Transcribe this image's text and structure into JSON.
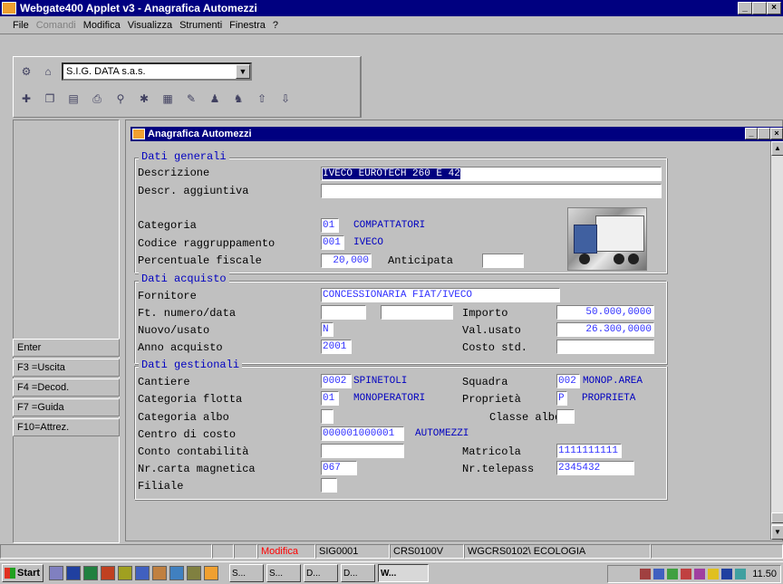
{
  "window": {
    "title": "Webgate400 Applet v3 - Anagrafica Automezzi",
    "btn_min": "_",
    "btn_max": " ",
    "btn_close": "×"
  },
  "menu": [
    "File",
    "Comandi",
    "Modifica",
    "Visualizza",
    "Strumenti",
    "Finestra",
    "?"
  ],
  "company_select": {
    "value": "S.I.G. DATA s.a.s."
  },
  "fkeys": [
    "Enter",
    "F3 =Uscita",
    "F4 =Decod.",
    "F7 =Guida",
    "F10=Attrez."
  ],
  "child": {
    "title": "Anagrafica Automezzi"
  },
  "groups": {
    "generali": "Dati generali",
    "acquisto": "Dati acquisto",
    "gestionali": "Dati gestionali"
  },
  "generali": {
    "descrizione_label": "Descrizione",
    "descrizione": "IVECO EUROTECH 260 E 42",
    "descr_agg_label": "Descr. aggiuntiva",
    "descr_agg": "",
    "categoria_label": "Categoria",
    "categoria_code": "01",
    "categoria_desc": "COMPATTATORI",
    "codice_ragg_label": "Codice raggruppamento",
    "codice_ragg_code": "001",
    "codice_ragg_desc": "IVECO",
    "perc_fiscale_label": "Percentuale fiscale",
    "perc_fiscale": "20,000",
    "anticipata_label": "Anticipata",
    "anticipata": ""
  },
  "acquisto": {
    "fornitore_label": "Fornitore",
    "fornitore": "CONCESSIONARIA FIAT/IVECO",
    "ft_label": "Ft. numero/data",
    "ft_numero": "",
    "ft_data": "",
    "importo_label": "Importo",
    "importo": "50.000,0000",
    "nuovo_label": "Nuovo/usato",
    "nuovo": "N",
    "val_usato_label": "Val.usato",
    "val_usato": "26.300,0000",
    "anno_label": "Anno acquisto",
    "anno": "2001",
    "costo_std_label": "Costo std.",
    "costo_std": ""
  },
  "gestionali": {
    "cantiere_label": "Cantiere",
    "cantiere_code": "0002",
    "cantiere_desc": "SPINETOLI",
    "squadra_label": "Squadra",
    "squadra_code": "002",
    "squadra_desc": "MONOP.AREA",
    "cat_flotta_label": "Categoria flotta",
    "cat_flotta_code": "01",
    "cat_flotta_desc": "MONOPERATORI",
    "proprieta_label": "Proprietà",
    "proprieta_code": "P",
    "proprieta_desc": "PROPRIETA",
    "cat_albo_label": "Categoria albo",
    "cat_albo": "",
    "classe_albo_label": "Classe albo",
    "classe_albo": "",
    "centro_costo_label": "Centro di costo",
    "centro_costo_code": "000001000001",
    "centro_costo_desc": "AUTOMEZZI",
    "conto_label": "Conto contabilità",
    "conto": "",
    "matricola_label": "Matricola",
    "matricola": "1111111111",
    "carta_label": "Nr.carta magnetica",
    "carta": "067",
    "telepass_label": "Nr.telepass",
    "telepass": "2345432",
    "filiale_label": "Filiale",
    "filiale": ""
  },
  "status": {
    "mode": "Modifica",
    "user": "SIG0001",
    "program": "CRS0100V",
    "session": "WGCRS0102\\ ECOLOGIA"
  },
  "taskbar": {
    "start": "Start",
    "tasks": [
      "S...",
      "S...",
      "D...",
      "D...",
      "W..."
    ],
    "clock": "11.50"
  },
  "colors": {
    "titlebar": "#000080",
    "field_text": "#3030ff",
    "group_title": "#0000c0",
    "status_mode": "#ff0000"
  }
}
